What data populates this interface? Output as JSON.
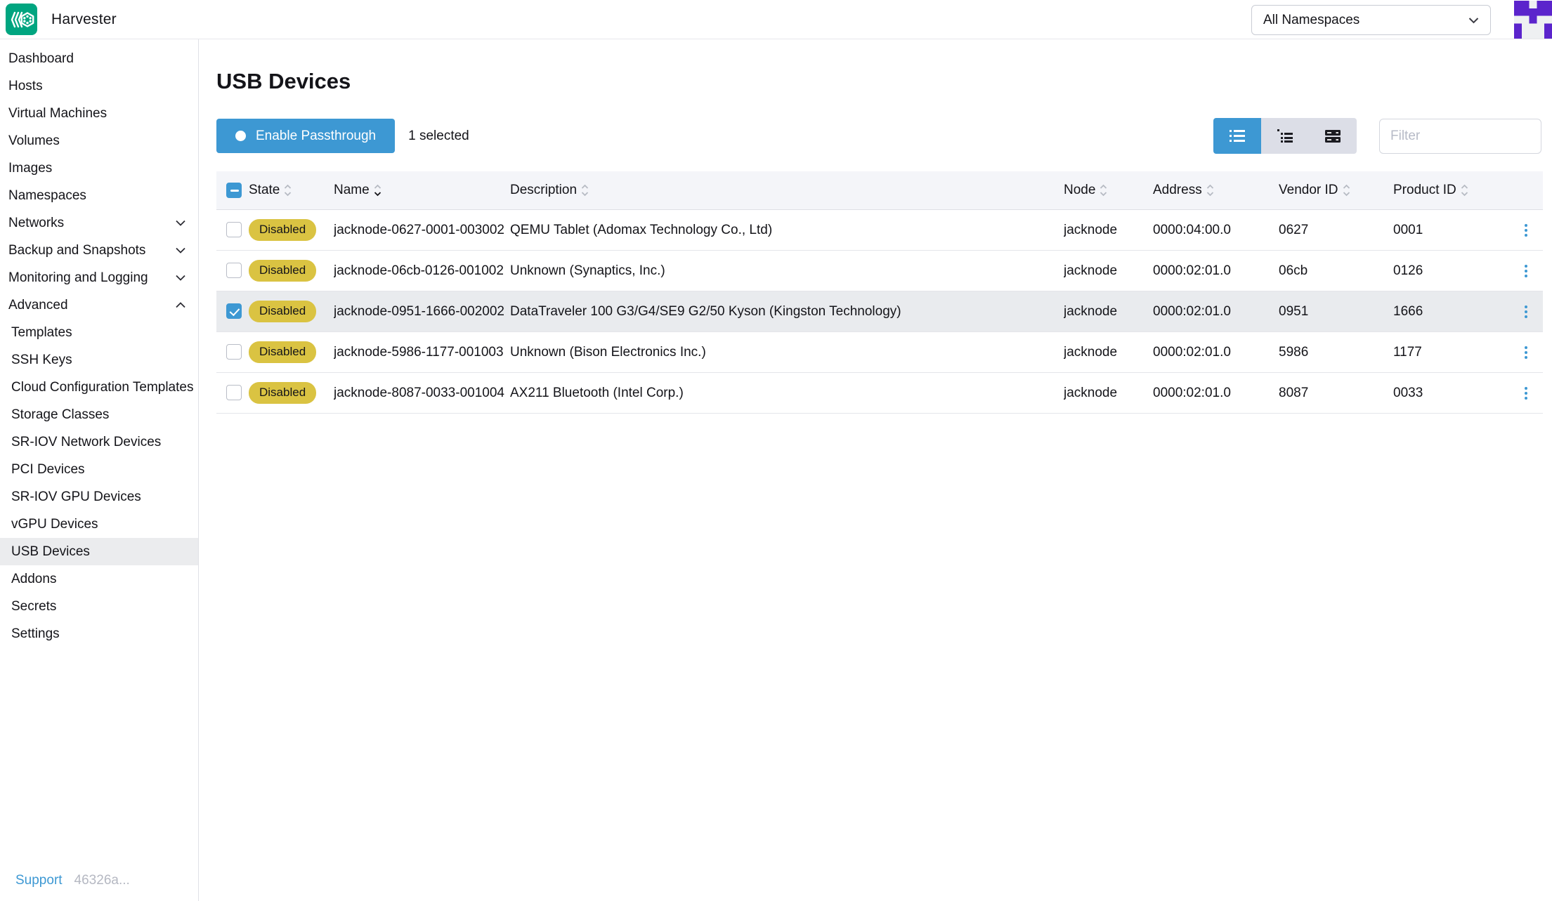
{
  "colors": {
    "primary": "#3d98d3",
    "badge_disabled_bg": "#dac342",
    "badge_disabled_text": "#141419",
    "logo_green": "#00a580",
    "avatar_purple": "#5b24cc",
    "selected_row_bg": "#e9ebee",
    "table_header_bg": "#f4f5f9"
  },
  "header": {
    "app_name": "Harvester",
    "logo_icon": "harvester-wheat-icon",
    "namespace_selector_value": "All Namespaces",
    "avatar_icon": "user-identicon"
  },
  "sidebar": {
    "items": [
      {
        "label": "Dashboard"
      },
      {
        "label": "Hosts"
      },
      {
        "label": "Virtual Machines"
      },
      {
        "label": "Volumes"
      },
      {
        "label": "Images"
      },
      {
        "label": "Namespaces"
      },
      {
        "label": "Networks",
        "expandable": true,
        "expanded": false
      },
      {
        "label": "Backup and Snapshots",
        "expandable": true,
        "expanded": false
      },
      {
        "label": "Monitoring and Logging",
        "expandable": true,
        "expanded": false
      },
      {
        "label": "Advanced",
        "expandable": true,
        "expanded": true
      },
      {
        "label": "Templates",
        "parent": "Advanced"
      },
      {
        "label": "SSH Keys",
        "parent": "Advanced"
      },
      {
        "label": "Cloud Configuration Templates",
        "parent": "Advanced"
      },
      {
        "label": "Storage Classes",
        "parent": "Advanced"
      },
      {
        "label": "SR-IOV Network Devices",
        "parent": "Advanced"
      },
      {
        "label": "PCI Devices",
        "parent": "Advanced"
      },
      {
        "label": "SR-IOV GPU Devices",
        "parent": "Advanced"
      },
      {
        "label": "vGPU Devices",
        "parent": "Advanced"
      },
      {
        "label": "USB Devices",
        "parent": "Advanced",
        "active": true
      },
      {
        "label": "Addons",
        "parent": "Advanced"
      },
      {
        "label": "Secrets",
        "parent": "Advanced"
      },
      {
        "label": "Settings",
        "parent": "Advanced"
      }
    ],
    "footer": {
      "support": "Support",
      "version": "46326a..."
    }
  },
  "page": {
    "title": "USB Devices"
  },
  "toolbar": {
    "primary_action": "Enable Passthrough",
    "selected_count": "1 selected",
    "filter_placeholder": "Filter",
    "view_modes": [
      "list-icon",
      "grouped-list-icon",
      "card-list-icon"
    ],
    "active_view": "list"
  },
  "table": {
    "select_all_state": "indeterminate",
    "columns": [
      {
        "label": "State",
        "sortable": true
      },
      {
        "label": "Name",
        "sortable": true,
        "active_sort": "down"
      },
      {
        "label": "Description",
        "sortable": true
      },
      {
        "label": "Node",
        "sortable": true
      },
      {
        "label": "Address",
        "sortable": true
      },
      {
        "label": "Vendor ID",
        "sortable": true
      },
      {
        "label": "Product ID",
        "sortable": true
      }
    ],
    "rows": [
      {
        "checked": false,
        "state": "Disabled",
        "name": "jacknode-0627-0001-003002",
        "description": "QEMU Tablet (Adomax Technology Co., Ltd)",
        "node": "jacknode",
        "address": "0000:04:00.0",
        "vendor_id": "0627",
        "product_id": "0001"
      },
      {
        "checked": false,
        "state": "Disabled",
        "name": "jacknode-06cb-0126-001002",
        "description": "Unknown (Synaptics, Inc.)",
        "node": "jacknode",
        "address": "0000:02:01.0",
        "vendor_id": "06cb",
        "product_id": "0126"
      },
      {
        "checked": true,
        "state": "Disabled",
        "name": "jacknode-0951-1666-002002",
        "description": "DataTraveler 100 G3/G4/SE9 G2/50 Kyson (Kingston Technology)",
        "node": "jacknode",
        "address": "0000:02:01.0",
        "vendor_id": "0951",
        "product_id": "1666"
      },
      {
        "checked": false,
        "state": "Disabled",
        "name": "jacknode-5986-1177-001003",
        "description": "Unknown (Bison Electronics Inc.)",
        "node": "jacknode",
        "address": "0000:02:01.0",
        "vendor_id": "5986",
        "product_id": "1177"
      },
      {
        "checked": false,
        "state": "Disabled",
        "name": "jacknode-8087-0033-001004",
        "description": "AX211 Bluetooth (Intel Corp.)",
        "node": "jacknode",
        "address": "0000:02:01.0",
        "vendor_id": "8087",
        "product_id": "0033"
      }
    ]
  }
}
